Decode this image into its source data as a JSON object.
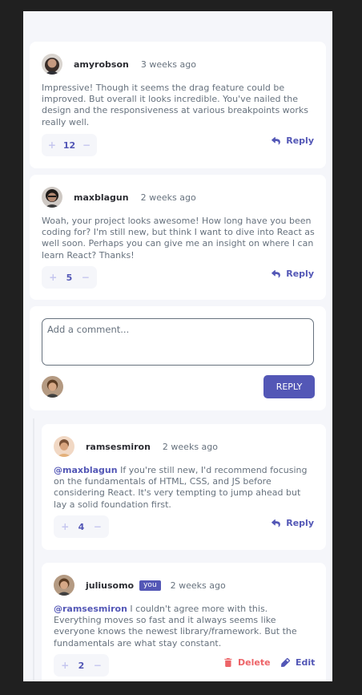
{
  "comments": [
    {
      "username": "amyrobson",
      "date": "3 weeks ago",
      "content": "Impressive! Though it seems the drag feature could be improved. But overall it looks incredible. You've nailed the design and the responsiveness at various breakpoints works really well.",
      "score": "12",
      "reply_label": "Reply"
    },
    {
      "username": "maxblagun",
      "date": "2 weeks ago",
      "content": "Woah, your project looks awesome! How long have you been coding for? I'm still new, but think I want to dive into React as well soon. Perhaps you can give me an insight on where I can learn React? Thanks!",
      "score": "5",
      "reply_label": "Reply"
    }
  ],
  "reply_form": {
    "placeholder": "Add a comment...",
    "submit_label": "REPLY"
  },
  "replies": [
    {
      "username": "ramsesmiron",
      "date": "2 weeks ago",
      "mention": "@maxblagun",
      "content": " If you're still new, I'd recommend focusing on the fundamentals of HTML, CSS, and JS before considering React. It's very tempting to jump ahead but lay a solid foundation first.",
      "score": "4",
      "reply_label": "Reply"
    },
    {
      "username": "juliusomo",
      "badge": "you",
      "date": "2 weeks ago",
      "mention": "@ramsesmiron",
      "content": " I couldn't agree more with this. Everything moves so fast and it always seems like everyone knows the newest library/framework. But the fundamentals are what stay constant.",
      "score": "2",
      "delete_label": "Delete",
      "edit_label": "Edit"
    }
  ],
  "vote": {
    "plus": "+",
    "minus": "−"
  },
  "icons": {
    "reply": "reply-icon",
    "delete": "trash-icon",
    "edit": "pencil-icon"
  },
  "colors": {
    "moderate_blue": "#5357b6",
    "soft_red": "#ed6468",
    "light_grayish_blue": "#c5c6ef",
    "grayish_blue": "#67727e",
    "dark_blue": "#2c2d33",
    "background": "#f5f6fa"
  }
}
